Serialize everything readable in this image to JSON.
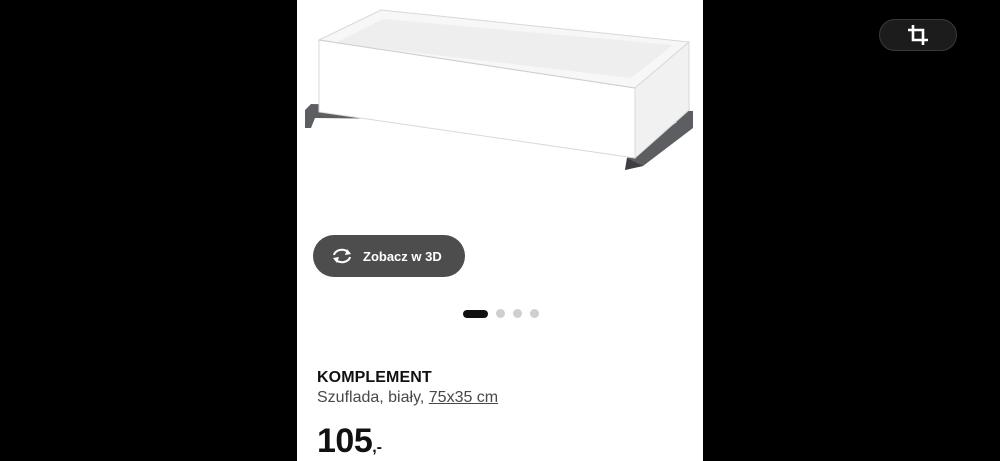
{
  "product": {
    "view3d_label": "Zobacz w 3D",
    "name": "KOMPLEMENT",
    "description": "Szuflada, biały, ",
    "size_link": "75x35 cm",
    "price_amount": "105",
    "price_suffix": ",-"
  },
  "carousel": {
    "total": 4,
    "active_index": 0
  },
  "icons": {
    "view3d": "rotate-3d-icon",
    "crop": "crop-icon"
  },
  "colors": {
    "background": "#000000",
    "panel": "#ffffff",
    "button": "#4d4d4d",
    "dot_active": "#111111",
    "dot_inactive": "#cfcfcf"
  }
}
